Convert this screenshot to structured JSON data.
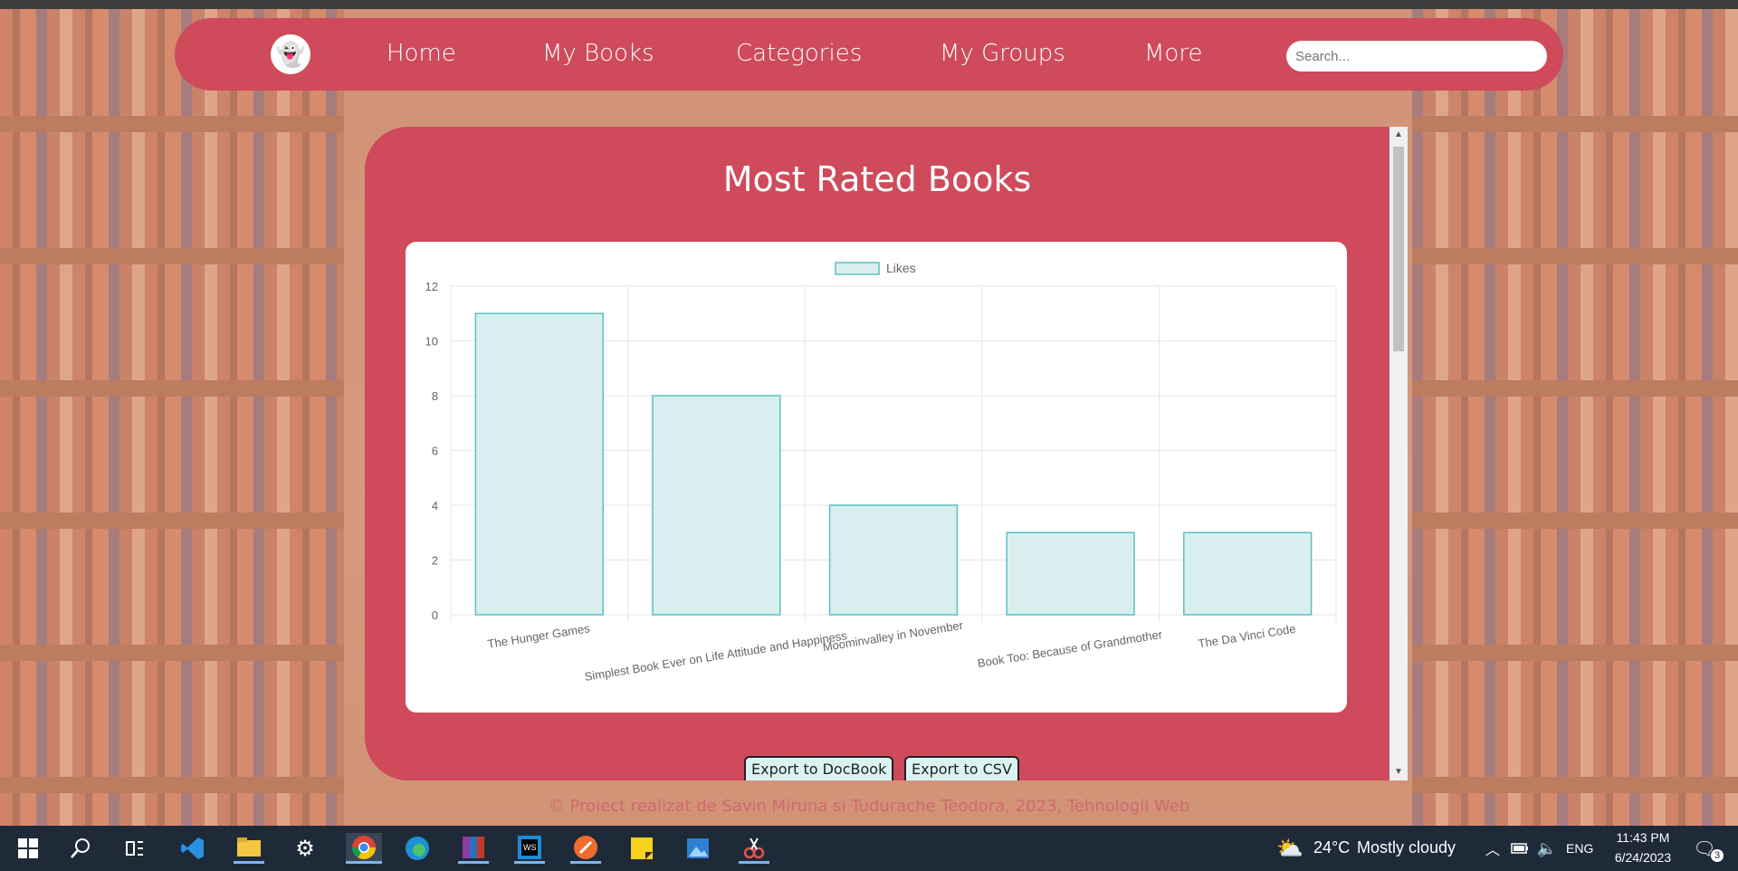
{
  "nav": {
    "logo_icon": "ghost-logo-icon",
    "links": [
      "Home",
      "My Books",
      "Categories",
      "My Groups",
      "More"
    ],
    "search_placeholder": "Search..."
  },
  "panel": {
    "title": "Most Rated Books",
    "buttons": {
      "docbook": "Export to DocBook",
      "csv": "Export to CSV"
    }
  },
  "chart_data": {
    "type": "bar",
    "categories": [
      "The Hunger Games",
      "Simplest Book Ever on Life Attitude and Happiness",
      "Moominvalley in November",
      "Book Too: Because of Grandmother",
      "The Da Vinci Code"
    ],
    "series": [
      {
        "name": "Likes",
        "values": [
          11,
          8,
          4,
          3,
          3
        ]
      }
    ],
    "ylim": [
      0,
      12
    ],
    "yticks": [
      0,
      2,
      4,
      6,
      8,
      10,
      12
    ],
    "grid": true,
    "legend": "top",
    "colors": {
      "fill": "#d9efef",
      "stroke": "#5bc0c0"
    }
  },
  "footer": "© Proiect realizat de Savin Miruna si Tudurache Teodora, 2023, Tehnologii Web",
  "taskbar": {
    "weather": {
      "temp": "24°C",
      "desc": "Mostly cloudy"
    },
    "lang": "ENG",
    "time": "11:43 PM",
    "date": "6/24/2023",
    "notifications": "3"
  }
}
